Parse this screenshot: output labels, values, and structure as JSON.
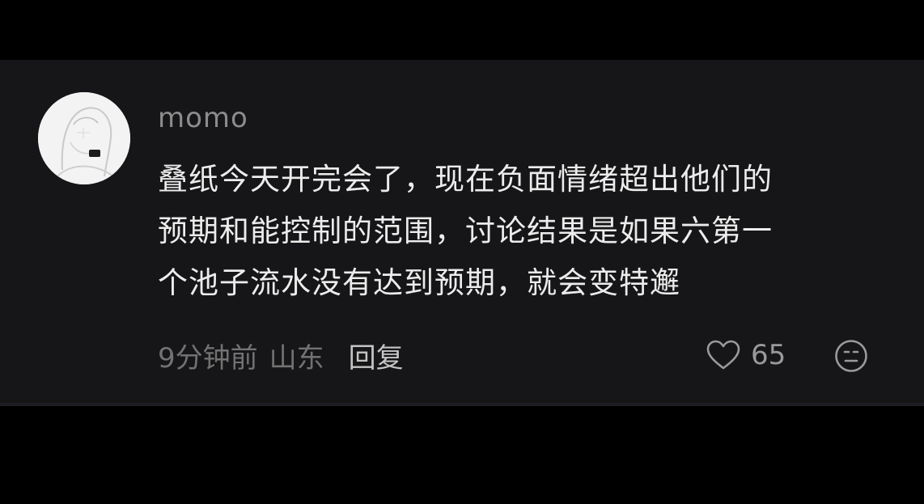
{
  "comment": {
    "username": "momo",
    "text_lines": [
      "叠纸今天开完会了，现在负面情绪超出他们的",
      "预期和能控制的范围，讨论结果是如果六第一",
      "个池子流水没有达到预期，就会变特邂"
    ],
    "time": "9分钟前",
    "location": "山东",
    "reply_label": "回复",
    "like_count": "65"
  },
  "icons": {
    "like": "heart-outline-icon",
    "dislike": "neutral-face-icon"
  },
  "colors": {
    "page_background": "#000000",
    "card_background": "#161618",
    "primary_text": "#ececec",
    "secondary_text": "#8c8c8c",
    "reply_text": "#c4c4c4"
  }
}
